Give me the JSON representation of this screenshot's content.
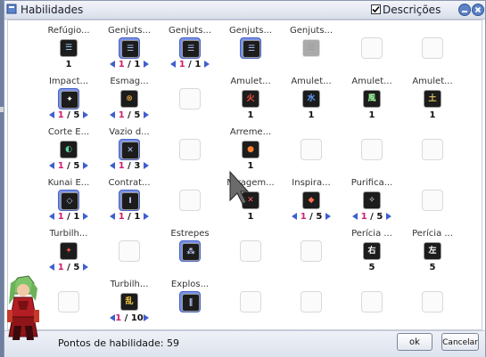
{
  "window": {
    "title": "Habilidades",
    "show_descriptions_label": "Descrições",
    "show_descriptions_checked": true
  },
  "skills": [
    {
      "name": "Refúgio...",
      "level": "1",
      "max": "",
      "adjustable": false,
      "selected": false,
      "glyph": "☰",
      "color": "#a0d8ff"
    },
    {
      "name": "Genjuts...",
      "level": "1",
      "max": "1",
      "adjustable": true,
      "selected": true,
      "glyph": "☰",
      "color": "#b0c4ff"
    },
    {
      "name": "Genjuts...",
      "level": "1",
      "max": "1",
      "adjustable": true,
      "selected": true,
      "glyph": "☰",
      "color": "#b0c4ff"
    },
    {
      "name": "Genjuts...",
      "level": "",
      "max": "",
      "adjustable": false,
      "selected": true,
      "glyph": "☰",
      "color": "#b0c4ff"
    },
    {
      "name": "Genjuts...",
      "level": "",
      "max": "",
      "adjustable": false,
      "selected": false,
      "glyph": "☰",
      "color": "#999999",
      "gray": true
    },
    {
      "name": "Impact...",
      "level": "1",
      "max": "5",
      "adjustable": true,
      "selected": true,
      "glyph": "✦",
      "color": "#ffffff"
    },
    {
      "name": "Esmag...",
      "level": "1",
      "max": "5",
      "adjustable": true,
      "selected": false,
      "glyph": "⊗",
      "color": "#e0a040"
    },
    {
      "name": "Amulet...",
      "level": "1",
      "max": "",
      "adjustable": false,
      "selected": false,
      "glyph": "火",
      "color": "#ff5040"
    },
    {
      "name": "Amulet...",
      "level": "1",
      "max": "",
      "adjustable": false,
      "selected": false,
      "glyph": "水",
      "color": "#60a0ff"
    },
    {
      "name": "Amulet...",
      "level": "1",
      "max": "",
      "adjustable": false,
      "selected": false,
      "glyph": "風",
      "color": "#a0ffa0"
    },
    {
      "name": "Amulet...",
      "level": "1",
      "max": "",
      "adjustable": false,
      "selected": false,
      "glyph": "土",
      "color": "#e0c060"
    },
    {
      "name": "Corte E...",
      "level": "1",
      "max": "5",
      "adjustable": true,
      "selected": false,
      "glyph": "◐",
      "color": "#60d0a0"
    },
    {
      "name": "Vazio d...",
      "level": "1",
      "max": "3",
      "adjustable": true,
      "selected": true,
      "glyph": "✕",
      "color": "#b0c4ff"
    },
    {
      "name": "Arreme...",
      "level": "1",
      "max": "",
      "adjustable": false,
      "selected": false,
      "glyph": "●",
      "color": "#ff8030"
    },
    {
      "name": "Kunai E...",
      "level": "1",
      "max": "1",
      "adjustable": true,
      "selected": true,
      "glyph": "◇",
      "color": "#c0d0ff"
    },
    {
      "name": "Contrat...",
      "level": "1",
      "max": "1",
      "adjustable": true,
      "selected": true,
      "glyph": "I",
      "color": "#c0d0ff"
    },
    {
      "name": "Miragem...",
      "level": "1",
      "max": "",
      "adjustable": false,
      "selected": false,
      "glyph": "✕",
      "color": "#ff6060"
    },
    {
      "name": "Inspira...",
      "level": "1",
      "max": "5",
      "adjustable": true,
      "selected": false,
      "glyph": "◆",
      "color": "#ff7050"
    },
    {
      "name": "Purifica...",
      "level": "1",
      "max": "5",
      "adjustable": true,
      "selected": false,
      "glyph": "✧",
      "color": "#ffffff"
    },
    {
      "name": "Turbilh...",
      "level": "1",
      "max": "5",
      "adjustable": true,
      "selected": false,
      "glyph": "✦",
      "color": "#ff5050"
    },
    {
      "name": "Estrepes",
      "level": "",
      "max": "",
      "adjustable": false,
      "selected": true,
      "glyph": "⁂",
      "color": "#c0d0ff"
    },
    {
      "name": "Perícia ...",
      "level": "5",
      "max": "",
      "adjustable": false,
      "selected": false,
      "glyph": "右",
      "color": "#ffffff"
    },
    {
      "name": "Perícia ...",
      "level": "5",
      "max": "",
      "adjustable": false,
      "selected": false,
      "glyph": "左",
      "color": "#ffffff"
    },
    {
      "name": "Turbilh...",
      "level": "1",
      "max": "10",
      "adjustable": true,
      "selected": false,
      "glyph": "乱",
      "color": "#ffd040"
    },
    {
      "name": "Explos...",
      "level": "",
      "max": "",
      "adjustable": false,
      "selected": true,
      "glyph": "∥",
      "color": "#c0d0ff"
    }
  ],
  "footer": {
    "points_label": "Pontos de habilidade:",
    "points_value": "59",
    "ok_label": "ok",
    "cancel_label": "Cancelar"
  }
}
